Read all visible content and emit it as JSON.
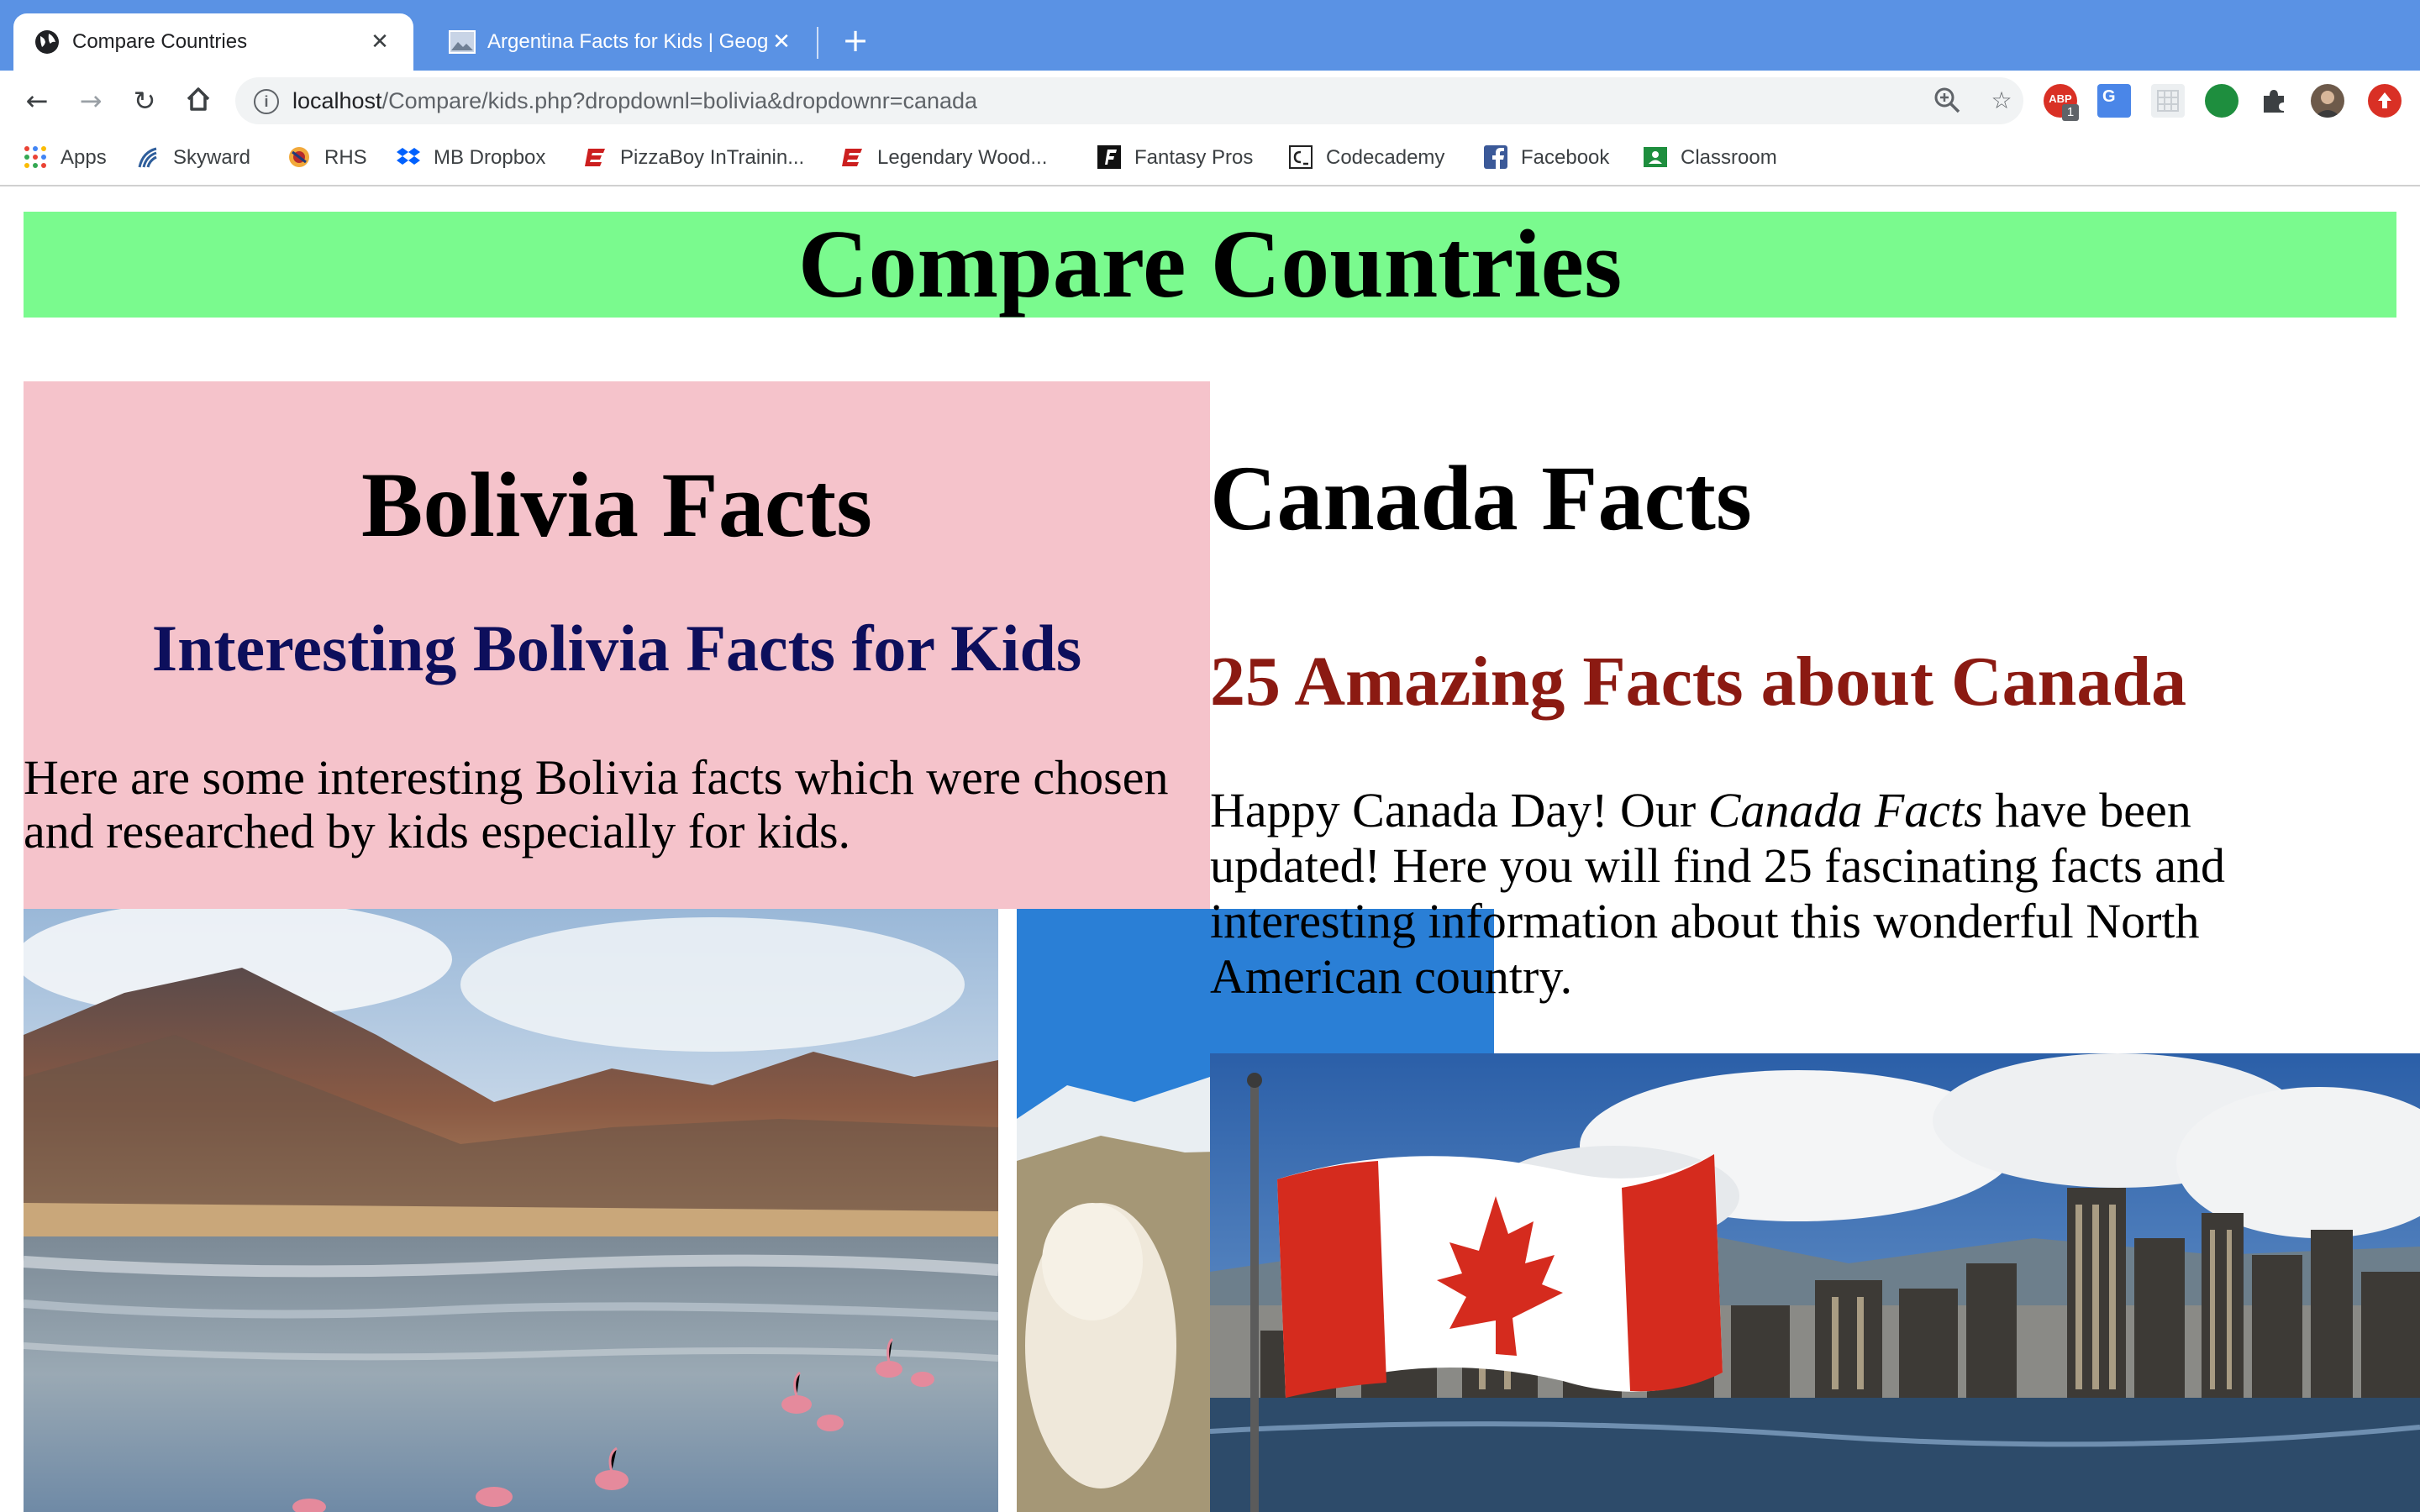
{
  "browser": {
    "tabs": [
      {
        "title": "Compare Countries",
        "active": true
      },
      {
        "title": "Argentina Facts for Kids | Geog",
        "active": false
      }
    ],
    "url_host": "localhost",
    "url_path": "/Compare/kids.php?dropdownl=bolivia&dropdownr=canada",
    "bookmarks": [
      "Apps",
      "Skyward",
      "RHS",
      "MB Dropbox",
      "PizzaBoy InTrainin...",
      "Legendary Wood...",
      "Fantasy Pros",
      "Codecademy",
      "Facebook",
      "Classroom"
    ],
    "extension_badge": "1",
    "extension_abp_label": "ABP"
  },
  "page": {
    "title": "Compare Countries",
    "left": {
      "heading": "Bolivia Facts",
      "subheading": "Interesting Bolivia Facts for Kids",
      "paragraph": "Here are some interesting Bolivia facts which were chosen and researched by kids especially for kids."
    },
    "right": {
      "heading": "Canada Facts",
      "subheading": "25 Amazing Facts about Canada",
      "paragraph_before": "Happy Canada Day! Our ",
      "paragraph_emphasis": "Canada Facts",
      "paragraph_after": " have been updated! Here you will find 25 fascinating facts and interesting information about this wonderful North American country."
    }
  },
  "colors": {
    "header_band": "#7afa8e",
    "left_panel": "#f5c3cb",
    "left_subheading": "#0d0f5c",
    "right_subheading": "#8b1a12",
    "tabbar": "#5a92e4"
  }
}
